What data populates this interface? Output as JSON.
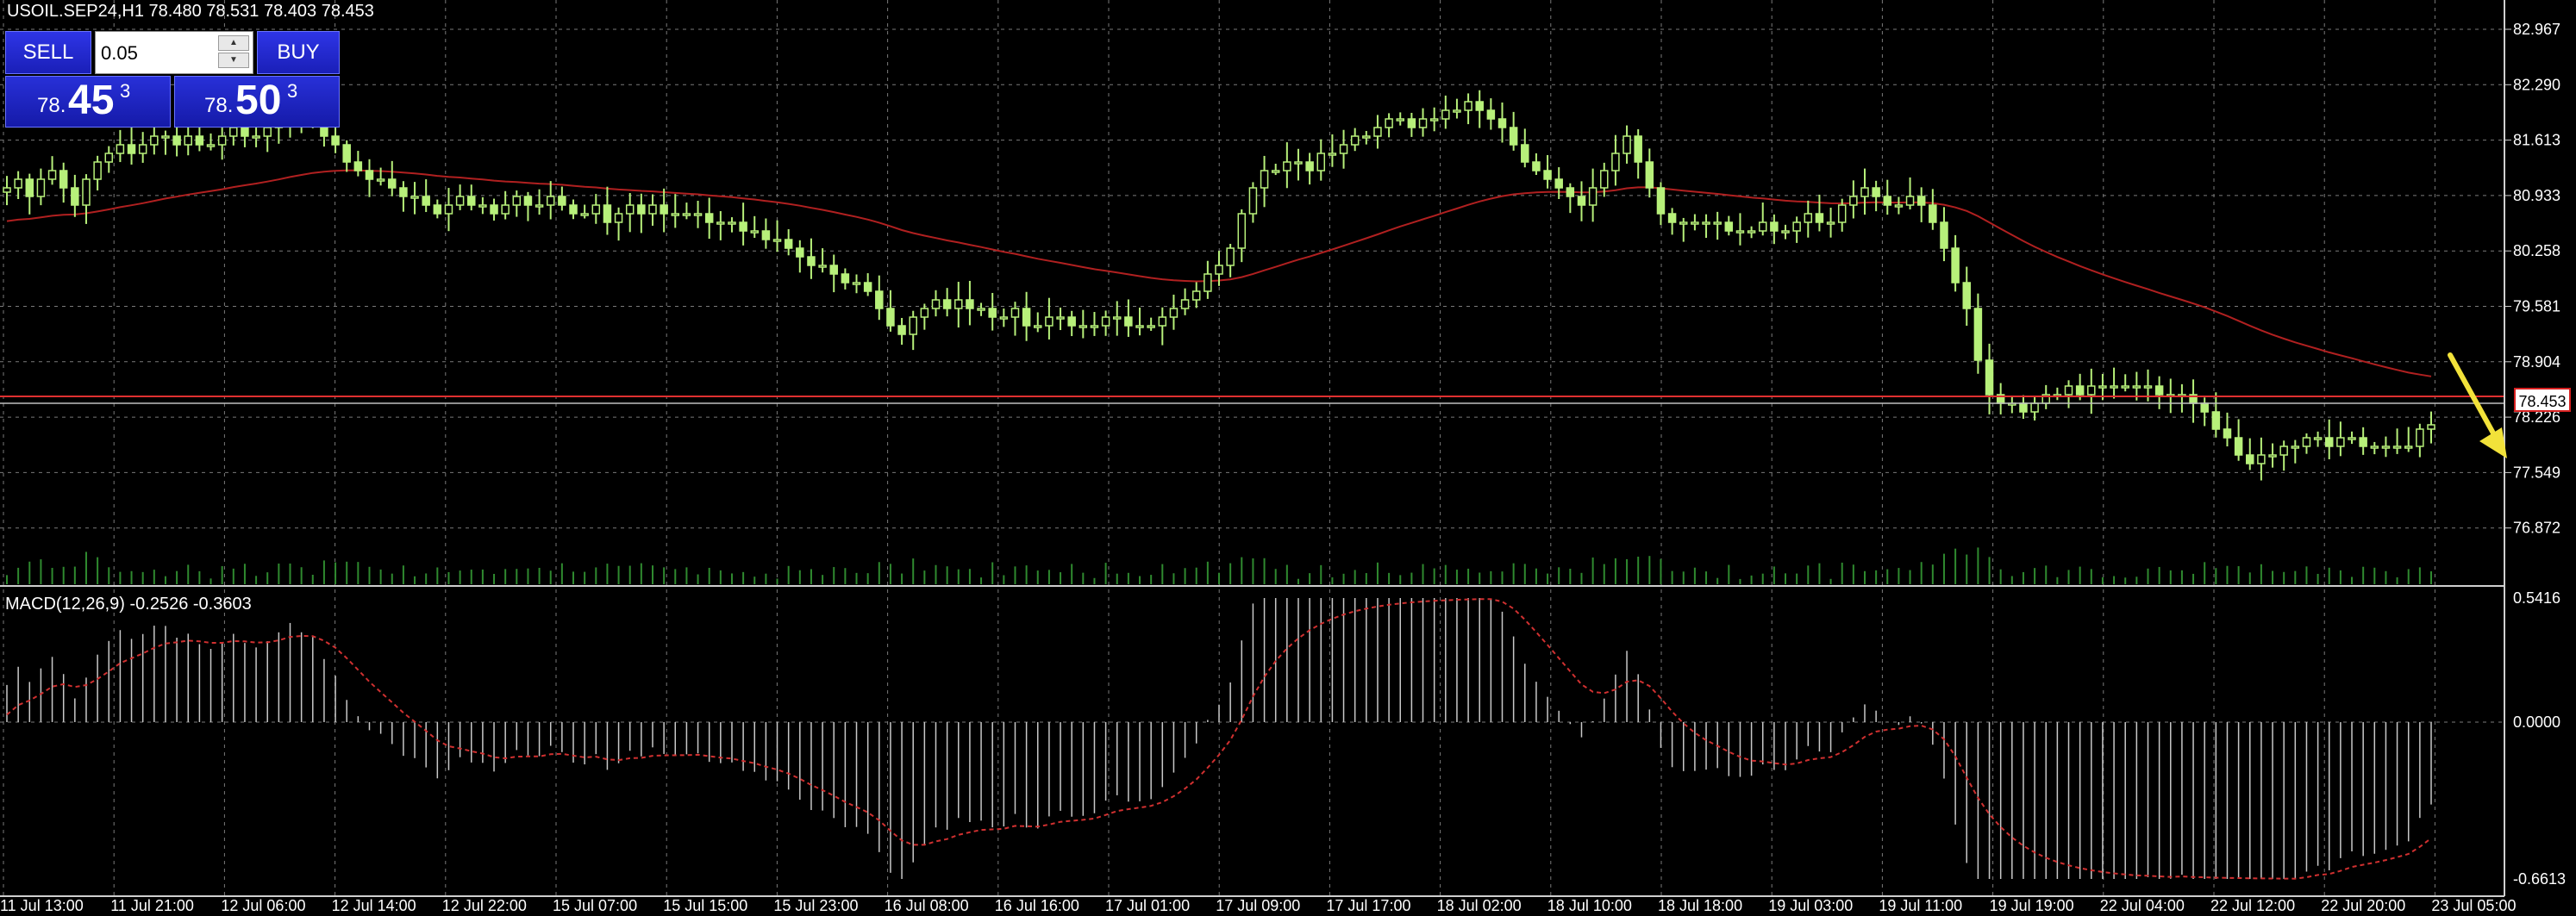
{
  "header": {
    "symbol_line": "USOIL.SEP24,H1  78.480 78.531 78.403 78.453"
  },
  "trade_panel": {
    "sell_label": "SELL",
    "buy_label": "BUY",
    "volume": "0.05",
    "bid": {
      "prefix": "78.",
      "big": "45",
      "sup": "3"
    },
    "ask": {
      "prefix": "78.",
      "big": "50",
      "sup": "3"
    }
  },
  "price_axis": {
    "labels": [
      "82.967",
      "82.290",
      "81.613",
      "80.933",
      "80.258",
      "79.581",
      "78.904",
      "78.226",
      "77.549",
      "76.872"
    ],
    "current_price": "78.453"
  },
  "macd": {
    "label": "MACD(12,26,9) -0.2526 -0.3603",
    "axis_labels": [
      "0.5416",
      "0.0000",
      "-0.6613"
    ]
  },
  "time_axis": {
    "labels": [
      "11 Jul 13:00",
      "11 Jul 21:00",
      "12 Jul 06:00",
      "12 Jul 14:00",
      "12 Jul 22:00",
      "15 Jul 07:00",
      "15 Jul 15:00",
      "15 Jul 23:00",
      "16 Jul 08:00",
      "16 Jul 16:00",
      "17 Jul 01:00",
      "17 Jul 09:00",
      "17 Jul 17:00",
      "18 Jul 02:00",
      "18 Jul 10:00",
      "18 Jul 18:00",
      "19 Jul 03:00",
      "19 Jul 11:00",
      "19 Jul 19:00",
      "22 Jul 04:00",
      "22 Jul 12:00",
      "22 Jul 20:00",
      "23 Jul 05:00"
    ]
  },
  "colors": {
    "background": "#000000",
    "grid": "#7a7a7a",
    "candle": "#b7f07a",
    "ma_line": "#b02020",
    "price_line": "#e03030",
    "arrow": "#f2e23a",
    "macd_hist": "#c8c8c8",
    "macd_signal": "#d03030"
  },
  "chart_data": {
    "type": "candlestick",
    "symbol": "USOIL.SEP24",
    "timeframe": "H1",
    "ylim": [
      76.6,
      83.2
    ],
    "close": [
      81.2,
      81.3,
      81.1,
      81.3,
      81.4,
      81.2,
      81.0,
      81.3,
      81.5,
      81.6,
      81.7,
      81.6,
      81.7,
      81.8,
      81.8,
      81.7,
      81.8,
      81.7,
      81.7,
      81.8,
      81.9,
      81.8,
      81.8,
      81.9,
      82.0,
      82.1,
      82.0,
      82.0,
      81.8,
      81.7,
      81.5,
      81.4,
      81.3,
      81.3,
      81.2,
      81.1,
      81.1,
      81.0,
      80.9,
      81.0,
      81.1,
      81.0,
      81.0,
      80.9,
      81.0,
      81.1,
      81.0,
      81.0,
      81.1,
      81.0,
      80.9,
      80.9,
      81.0,
      80.8,
      80.9,
      81.0,
      80.9,
      81.0,
      80.9,
      80.9,
      80.9,
      80.9,
      80.8,
      80.8,
      80.8,
      80.7,
      80.7,
      80.6,
      80.6,
      80.5,
      80.4,
      80.3,
      80.3,
      80.2,
      80.1,
      80.1,
      80.0,
      79.8,
      79.6,
      79.5,
      79.7,
      79.8,
      79.9,
      79.8,
      79.9,
      79.8,
      79.8,
      79.7,
      79.7,
      79.8,
      79.6,
      79.6,
      79.7,
      79.7,
      79.6,
      79.6,
      79.6,
      79.7,
      79.7,
      79.6,
      79.6,
      79.6,
      79.7,
      79.8,
      79.9,
      80.0,
      80.2,
      80.3,
      80.5,
      80.9,
      81.2,
      81.4,
      81.4,
      81.5,
      81.5,
      81.4,
      81.6,
      81.6,
      81.7,
      81.8,
      81.8,
      81.9,
      82.0,
      82.0,
      81.9,
      82.0,
      82.0,
      82.1,
      82.1,
      82.2,
      82.1,
      82.0,
      81.9,
      81.7,
      81.5,
      81.4,
      81.3,
      81.2,
      81.1,
      81.0,
      81.2,
      81.4,
      81.6,
      81.8,
      81.5,
      81.2,
      80.9,
      80.8,
      80.8,
      80.8,
      80.8,
      80.8,
      80.7,
      80.7,
      80.7,
      80.8,
      80.7,
      80.7,
      80.8,
      80.9,
      80.8,
      80.8,
      81.0,
      81.1,
      81.2,
      81.1,
      81.0,
      81.0,
      81.1,
      81.0,
      80.8,
      80.5,
      80.1,
      79.8,
      79.2,
      78.8,
      78.7,
      78.7,
      78.6,
      78.7,
      78.8,
      78.8,
      78.9,
      78.8,
      78.9,
      78.9,
      78.9,
      78.9,
      78.9,
      78.9,
      78.8,
      78.8,
      78.8,
      78.7,
      78.6,
      78.4,
      78.3,
      78.1,
      78.0,
      78.1,
      78.1,
      78.2,
      78.2,
      78.3,
      78.3,
      78.2,
      78.3,
      78.3,
      78.2,
      78.2,
      78.2,
      78.2,
      78.2,
      78.4,
      78.45
    ],
    "ma_from": 80.8,
    "current_price": 78.453,
    "macd": {
      "fast": 12,
      "slow": 26,
      "signal": 9,
      "main_last": -0.2526,
      "signal_last": -0.3603,
      "ylim": [
        -0.6613,
        0.5416
      ]
    }
  }
}
